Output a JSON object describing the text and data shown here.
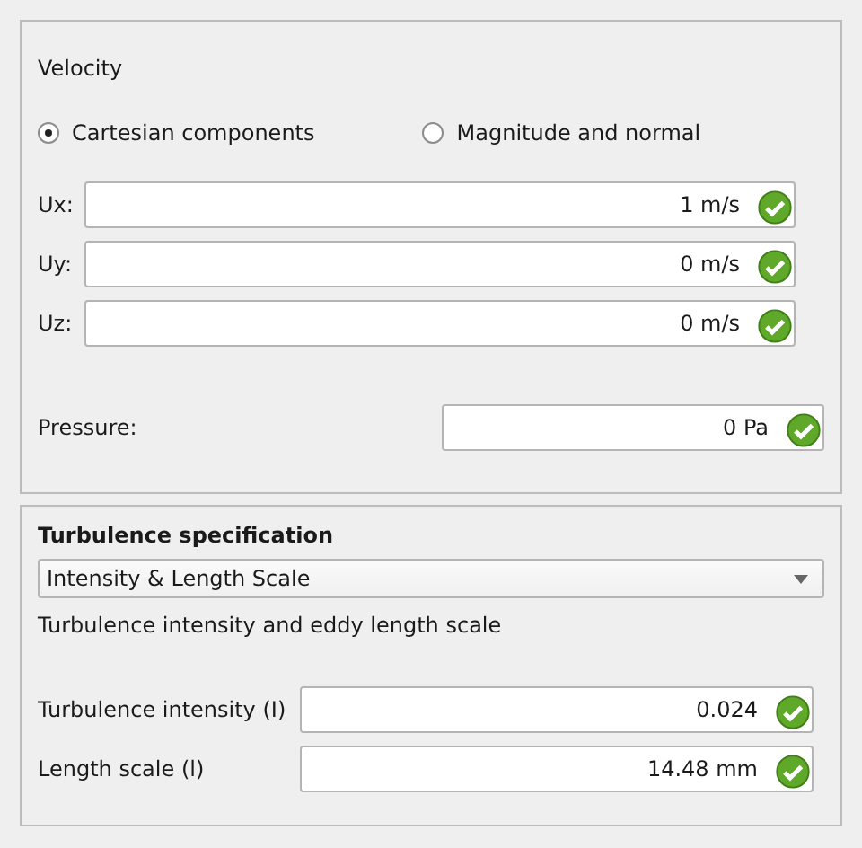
{
  "velocity": {
    "title": "Velocity",
    "modes": [
      {
        "label": "Cartesian components",
        "selected": true
      },
      {
        "label": "Magnitude and normal",
        "selected": false
      }
    ],
    "components": [
      {
        "label": "Ux:",
        "value": "1 m/s",
        "valid": true
      },
      {
        "label": "Uy:",
        "value": "0 m/s",
        "valid": true
      },
      {
        "label": "Uz:",
        "value": "0 m/s",
        "valid": true
      }
    ],
    "pressure": {
      "label": "Pressure:",
      "value": "0 Pa",
      "valid": true
    }
  },
  "turbulence": {
    "title": "Turbulence specification",
    "dropdown": "Intensity & Length Scale",
    "description": "Turbulence intensity and eddy length scale",
    "fields": [
      {
        "label": "Turbulence intensity (I)",
        "value": "0.024",
        "valid": true
      },
      {
        "label": "Length scale (l)",
        "value": "14.48 mm",
        "valid": true
      }
    ]
  }
}
